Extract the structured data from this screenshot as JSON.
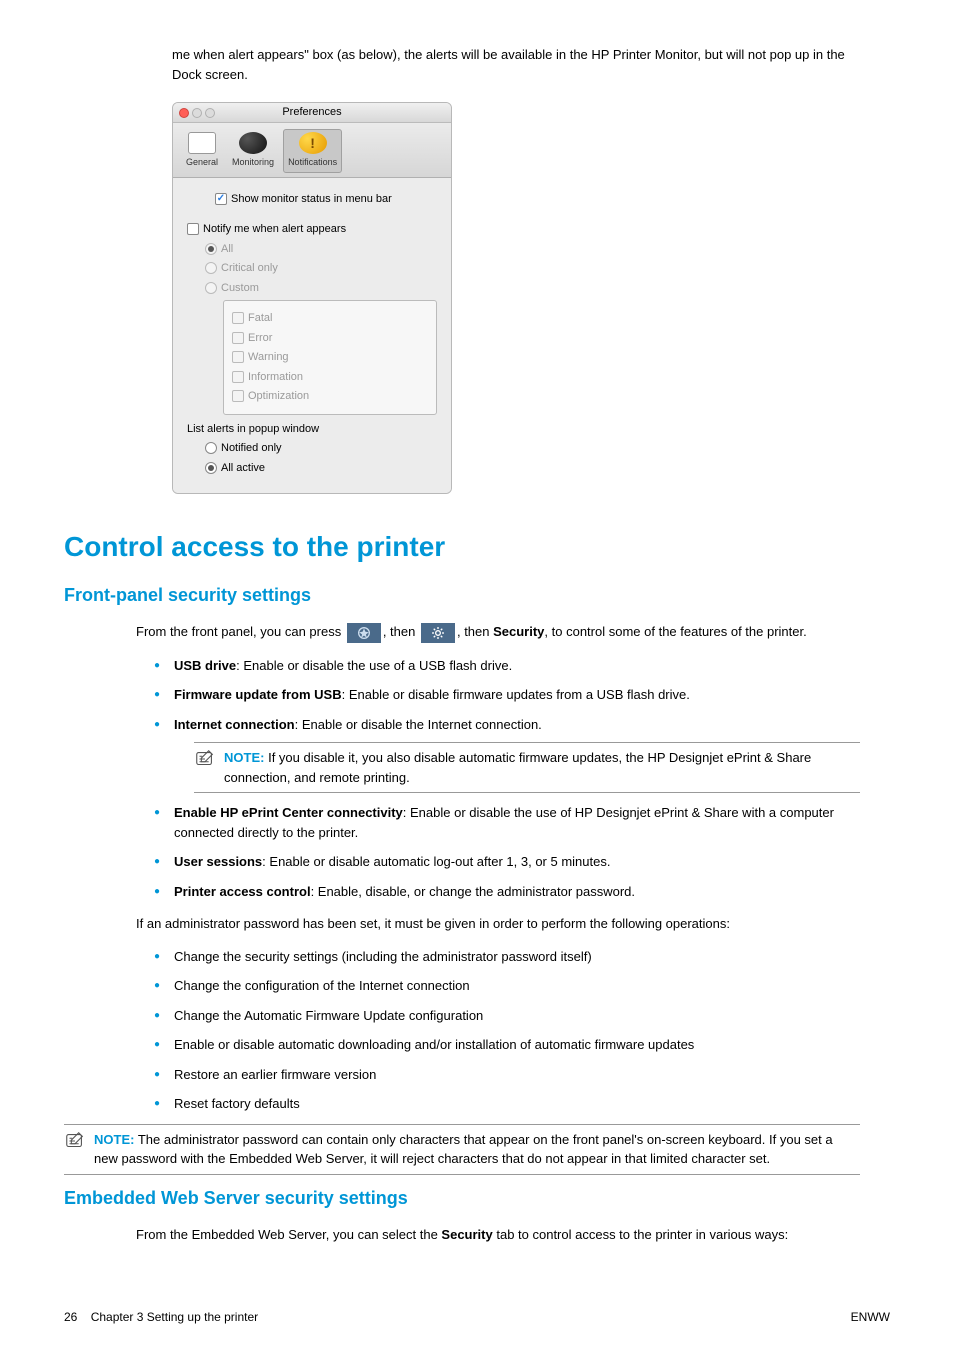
{
  "intro": "me when alert appears\" box (as below), the alerts will be available in the HP Printer Monitor, but will not pop up in the Dock screen.",
  "prefs": {
    "window_title": "Preferences",
    "toolbar": {
      "general": "General",
      "monitoring": "Monitoring",
      "notifications": "Notifications"
    },
    "show_menu_bar": "Show monitor status in menu bar",
    "notify_me": "Notify me when alert appears",
    "all": "All",
    "critical_only": "Critical only",
    "custom": "Custom",
    "fatal": "Fatal",
    "error": "Error",
    "warning": "Warning",
    "information": "Information",
    "optimization": "Optimization",
    "list_alerts": "List alerts in popup window",
    "notified_only": "Notified only",
    "all_active": "All active"
  },
  "h1": "Control access to the printer",
  "h2_front": "Front-panel security settings",
  "front_intro_a": "From the front panel, you can press ",
  "front_intro_b": ", then ",
  "front_intro_c": ", then ",
  "front_intro_d": "Security",
  "front_intro_e": ", to control some of the features of the printer.",
  "bullets1": {
    "b1_a": "USB drive",
    "b1_b": ": Enable or disable the use of a USB flash drive.",
    "b2_a": "Firmware update from USB",
    "b2_b": ": Enable or disable firmware updates from a USB flash drive.",
    "b3_a": "Internet connection",
    "b3_b": ": Enable or disable the Internet connection.",
    "note1_label": "NOTE:",
    "note1_text": "If you disable it, you also disable automatic firmware updates, the HP Designjet ePrint & Share connection, and remote printing.",
    "b4_a": "Enable HP ePrint Center connectivity",
    "b4_b": ": Enable or disable the use of HP Designjet ePrint & Share with a computer connected directly to the printer.",
    "b5_a": "User sessions",
    "b5_b": ": Enable or disable automatic log-out after 1, 3, or 5 minutes.",
    "b6_a": "Printer access control",
    "b6_b": ": Enable, disable, or change the administrator password."
  },
  "admin_intro": "If an administrator password has been set, it must be given in order to perform the following operations:",
  "bullets2": {
    "b1": "Change the security settings (including the administrator password itself)",
    "b2": "Change the configuration of the Internet connection",
    "b3": "Change the Automatic Firmware Update configuration",
    "b4": "Enable or disable automatic downloading and/or installation of automatic firmware updates",
    "b5": "Restore an earlier firmware version",
    "b6": "Reset factory defaults"
  },
  "note2_label": "NOTE:",
  "note2_text": "The administrator password can contain only characters that appear on the front panel's on-screen keyboard. If you set a new password with the Embedded Web Server, it will reject characters that do not appear in that limited character set.",
  "h2_ews": "Embedded Web Server security settings",
  "ews_intro_a": "From the Embedded Web Server, you can select the ",
  "ews_intro_b": "Security",
  "ews_intro_c": " tab to control access to the printer in various ways:",
  "footer": {
    "left_page": "26",
    "left_text": "Chapter 3   Setting up the printer",
    "right": "ENWW"
  }
}
